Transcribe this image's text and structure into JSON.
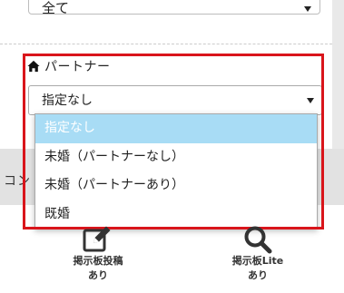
{
  "top_select": {
    "value": "全て"
  },
  "partner_filter": {
    "heading": "パートナー",
    "selected_value": "指定なし",
    "options": [
      "指定なし",
      "未婚（パートナーなし）",
      "未婚（パートナーあり）",
      "既婚"
    ]
  },
  "section_band": {
    "title_fragment": "コン"
  },
  "footer": {
    "post_button": {
      "line1": "掲示板投稿",
      "line2": "あり"
    },
    "lite_button": {
      "line1": "掲示板Lite",
      "line2": "あり"
    }
  },
  "colors": {
    "highlight_border": "#d9151b",
    "selected_option_bg": "#a8dcf5",
    "band_bg": "#e2e2e2"
  },
  "icons": {
    "heading_icon": "home-icon",
    "post_icon": "edit-icon",
    "lite_icon": "search-icon"
  }
}
